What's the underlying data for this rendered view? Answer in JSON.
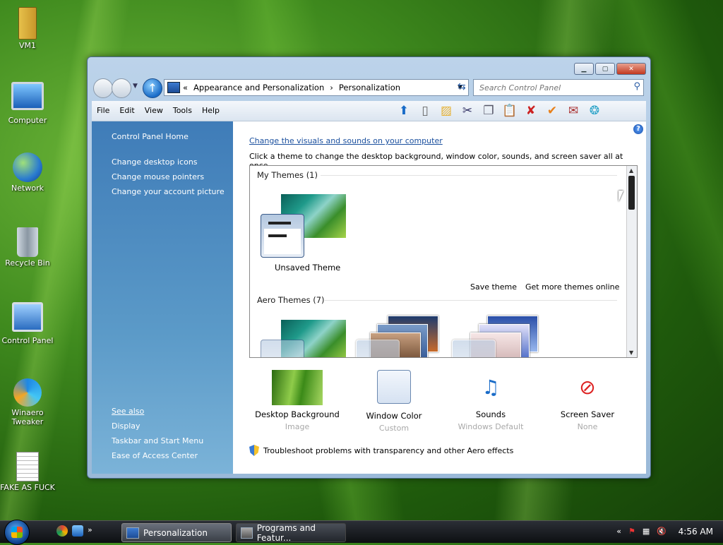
{
  "desktop": {
    "icons": [
      {
        "label": "VM1"
      },
      {
        "label": "Computer"
      },
      {
        "label": "Network"
      },
      {
        "label": "Recycle Bin"
      },
      {
        "label": "Control Panel"
      },
      {
        "label": "Winaero Tweaker"
      },
      {
        "label": "FAKE AS FUCK"
      }
    ]
  },
  "window": {
    "address": {
      "breadcrumbs": [
        "Appearance and Personalization",
        "Personalization"
      ]
    },
    "search_placeholder": "Search Control Panel",
    "menu": [
      "File",
      "Edit",
      "View",
      "Tools",
      "Help"
    ],
    "left_pane": {
      "home": "Control Panel Home",
      "tasks": [
        "Change desktop icons",
        "Change mouse pointers",
        "Change your account picture"
      ],
      "see_also_title": "See also",
      "see_also": [
        "Display",
        "Taskbar and Start Menu",
        "Ease of Access Center"
      ]
    },
    "main": {
      "title_link": "Change the visuals and sounds on your computer",
      "description": "Click a theme to change the desktop background, window color, sounds, and screen saver all at once.",
      "groups": {
        "my_themes": "My Themes (1)",
        "aero_themes": "Aero Themes (7)"
      },
      "unsaved_theme": "Unsaved Theme",
      "save_theme": "Save theme",
      "get_more": "Get more themes online",
      "items": [
        {
          "title": "Desktop Background",
          "sub": "Image"
        },
        {
          "title": "Window Color",
          "sub": "Custom"
        },
        {
          "title": "Sounds",
          "sub": "Windows Default"
        },
        {
          "title": "Screen Saver",
          "sub": "None"
        }
      ],
      "troubleshoot": "Troubleshoot problems with transparency and other Aero effects"
    }
  },
  "taskbar": {
    "buttons": [
      {
        "label": "Personalization"
      },
      {
        "label": "Programs and Featur..."
      }
    ],
    "clock": "4:56 AM"
  }
}
